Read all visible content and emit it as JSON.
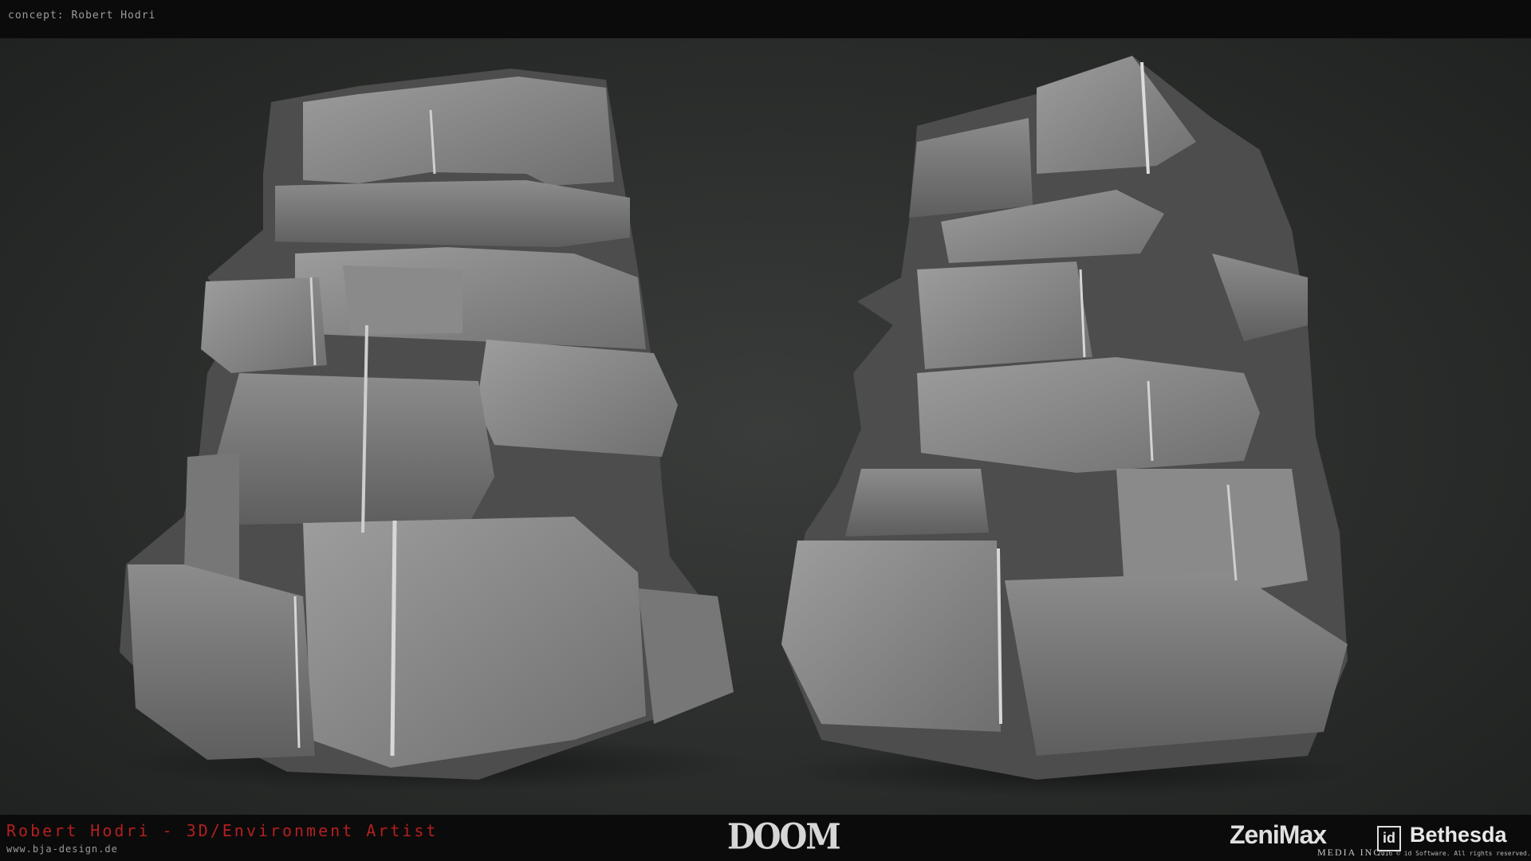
{
  "header": {
    "concept_credit": "concept: Robert Hodri"
  },
  "footer": {
    "artist_title": "Robert Hodri - 3D/Environment Artist",
    "website": "www.bja-design.de",
    "game_logo_text": "DOOM",
    "publisher_logo_text": "ZeniMax",
    "publisher_sub_text": "MEDIA INC.",
    "developer_logo_text": "id",
    "bethesda_logo_text": "Bethesda",
    "copyright": "2016 © id Software. All rights reserved."
  },
  "colors": {
    "accent_red": "#b3201f",
    "background": "#2f3130",
    "stone_light": "#9a9a9a",
    "stone_dark": "#5b5b5b"
  }
}
